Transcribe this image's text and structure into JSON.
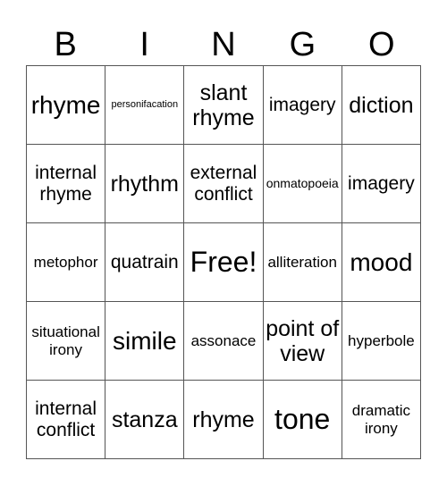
{
  "header": {
    "letters": [
      "B",
      "I",
      "N",
      "G",
      "O"
    ]
  },
  "board": {
    "rows": [
      [
        "rhyme",
        "personifacation",
        "slant rhyme",
        "imagery",
        "diction"
      ],
      [
        "internal rhyme",
        "rhythm",
        "external conflict",
        "onmatopoeia",
        "imagery"
      ],
      [
        "metophor",
        "quatrain",
        "Free!",
        "alliteration",
        "mood"
      ],
      [
        "situational irony",
        "simile",
        "assonace",
        "point of view",
        "hyperbole"
      ],
      [
        "internal conflict",
        "stanza",
        "rhyme",
        "tone",
        "dramatic irony"
      ]
    ]
  },
  "colors": {
    "grid_line": "#555555",
    "text": "#000000",
    "background": "#ffffff"
  }
}
